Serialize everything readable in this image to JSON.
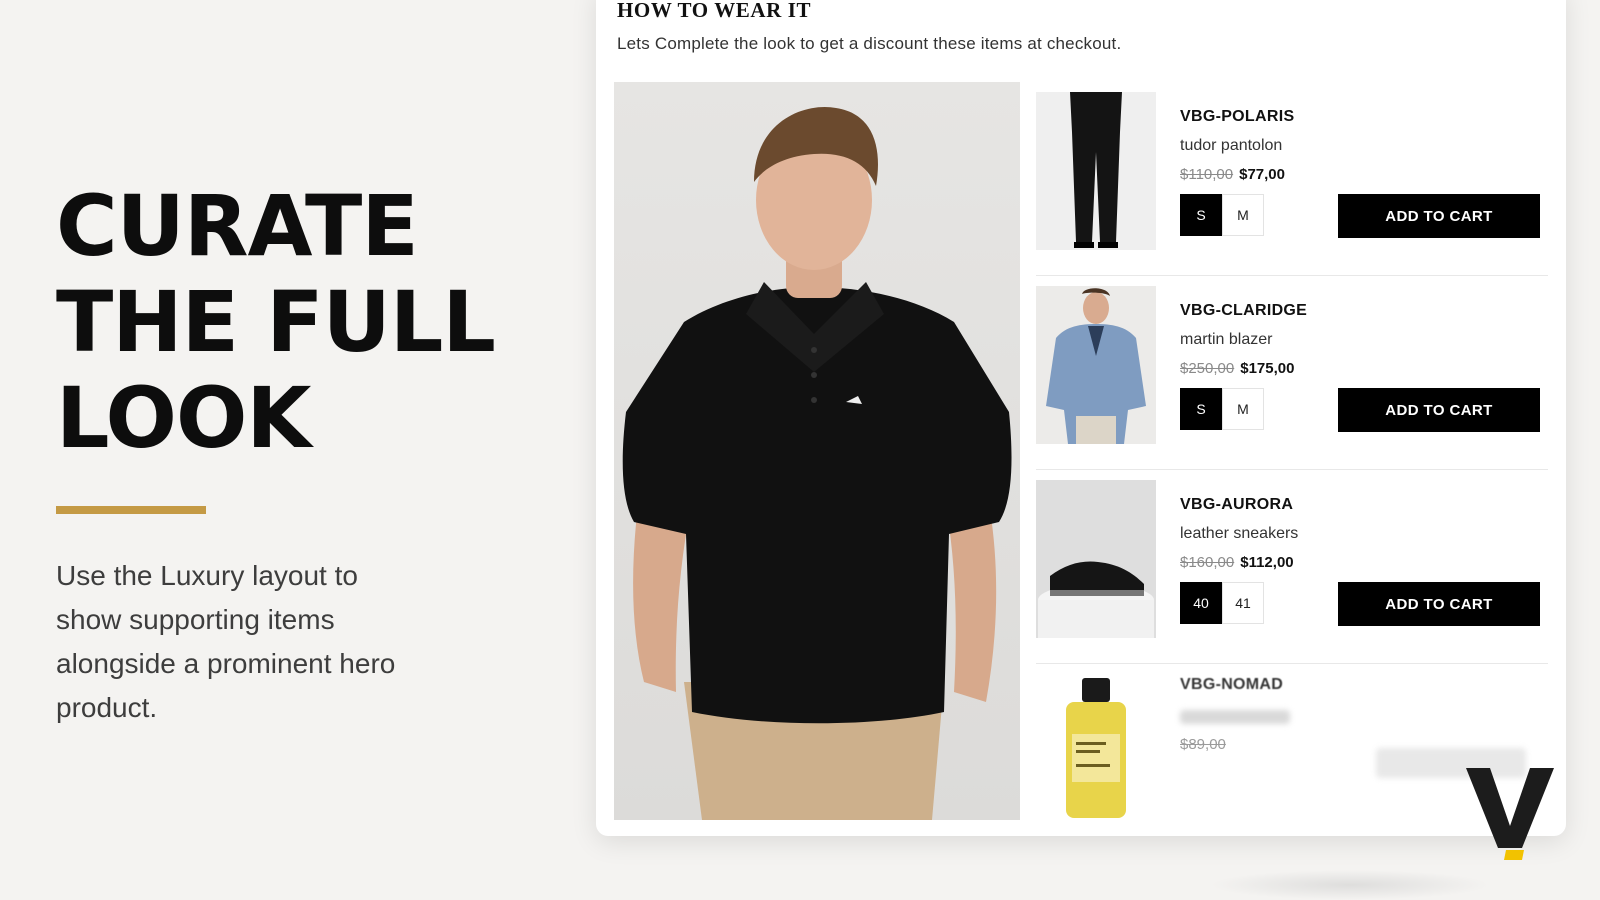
{
  "promo": {
    "title_lines": [
      "CURATE",
      "THE FULL",
      "LOOK"
    ],
    "description": "Use the Luxury layout to show supporting items alongside a prominent hero product.",
    "accent_color": "#c49a45"
  },
  "card": {
    "heading": "HOW TO WEAR IT",
    "subheading": "Lets Complete the look to get a discount these items at checkout.",
    "hero_image": "man-in-black-polo-shirt"
  },
  "products": [
    {
      "name": "VBG-POLARIS",
      "description": "tudor pantolon",
      "old_price": "$110,00",
      "new_price": "$77,00",
      "sizes": [
        "S",
        "M"
      ],
      "selected_size": "S",
      "cta": "ADD TO CART",
      "image": "black-trousers"
    },
    {
      "name": "VBG-CLARIDGE",
      "description": "martin blazer",
      "old_price": "$250,00",
      "new_price": "$175,00",
      "sizes": [
        "S",
        "M"
      ],
      "selected_size": "S",
      "cta": "ADD TO CART",
      "image": "blue-blazer"
    },
    {
      "name": "VBG-AURORA",
      "description": "leather sneakers",
      "old_price": "$160,00",
      "new_price": "$112,00",
      "sizes": [
        "40",
        "41"
      ],
      "selected_size": "40",
      "cta": "ADD TO CART",
      "image": "black-sneaker"
    },
    {
      "name": "VBG-NOMAD",
      "old_price": "$89,00",
      "image": "perfume-bottle"
    }
  ],
  "colors": {
    "background": "#f4f3f1",
    "button": "#000000",
    "logo_accent": "#f2c200"
  }
}
